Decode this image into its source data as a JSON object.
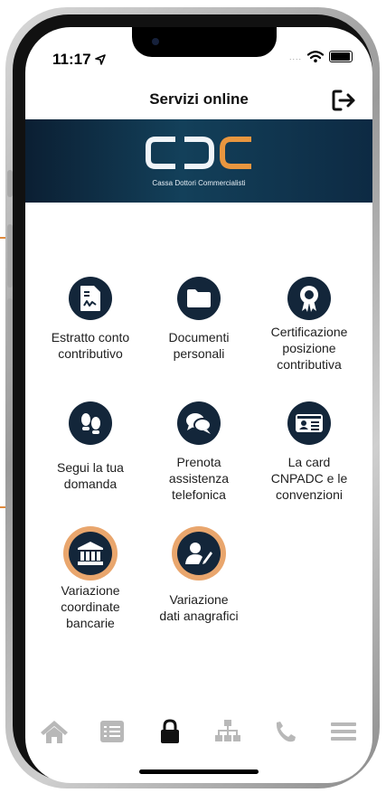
{
  "status": {
    "time": "11:17"
  },
  "header": {
    "title": "Servizi online",
    "logout_icon": "logout-icon"
  },
  "banner": {
    "logo_text": "CDC",
    "subtitle": "Cassa Dottori Commercialisti"
  },
  "services": [
    {
      "label_lines": [
        "Estratto conto",
        "contributivo"
      ],
      "icon": "document-signature-icon"
    },
    {
      "label_lines": [
        "Documenti",
        "personali"
      ],
      "icon": "folder-icon"
    },
    {
      "label_lines": [
        "Certificazione",
        "posizione",
        "contributiva"
      ],
      "icon": "certificate-icon"
    },
    {
      "label_lines": [
        "Segui la tua",
        "domanda"
      ],
      "icon": "footprints-icon"
    },
    {
      "label_lines": [
        "Prenota",
        "assistenza",
        "telefonica"
      ],
      "icon": "chat-icon"
    },
    {
      "label_lines": [
        "La card",
        "CNPADC e le",
        "convenzioni"
      ],
      "icon": "id-card-icon"
    },
    {
      "label_lines": [
        "Variazione",
        "coordinate",
        "bancarie"
      ],
      "icon": "bank-icon"
    },
    {
      "label_lines": [
        "Variazione",
        "dati anagrafici"
      ],
      "icon": "user-edit-icon"
    }
  ],
  "tabbar": [
    {
      "name": "home-icon",
      "active": false
    },
    {
      "name": "list-icon",
      "active": false
    },
    {
      "name": "lock-icon",
      "active": true
    },
    {
      "name": "network-icon",
      "active": false
    },
    {
      "name": "phone-icon",
      "active": false
    },
    {
      "name": "menu-icon",
      "active": false
    }
  ],
  "colors": {
    "icon_bg": "#13263a",
    "accent_ring": "#e9a66d",
    "tab_inactive": "#b8b8b8",
    "tab_active": "#111111"
  }
}
